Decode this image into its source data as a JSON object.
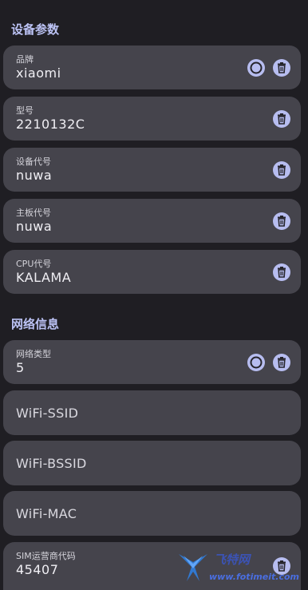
{
  "sections": {
    "device_params": "设备参数",
    "network_info": "网络信息"
  },
  "fields": {
    "brand": {
      "label": "品牌",
      "value": "xiaomi"
    },
    "model": {
      "label": "型号",
      "value": "2210132C"
    },
    "device_code": {
      "label": "设备代号",
      "value": "nuwa"
    },
    "board_code": {
      "label": "主板代号",
      "value": "nuwa"
    },
    "cpu_code": {
      "label": "CPU代号",
      "value": "KALAMA"
    },
    "network_type": {
      "label": "网络类型",
      "value": "5"
    },
    "wifi_ssid": {
      "placeholder": "WiFi-SSID"
    },
    "wifi_bssid": {
      "placeholder": "WiFi-BSSID"
    },
    "wifi_mac": {
      "placeholder": "WiFi-MAC"
    },
    "sim_operator": {
      "label": "SIM运营商代码",
      "value": "45407"
    }
  },
  "watermark": {
    "text": "飞特网",
    "url": "www.fotimeit.com"
  },
  "colors": {
    "background": "#1f1e23",
    "card": "#45444c",
    "accent": "#b7bdf0",
    "section_title": "#bcc3f5"
  },
  "icons": {
    "delete": "trash-icon",
    "reset": "circle-icon"
  }
}
